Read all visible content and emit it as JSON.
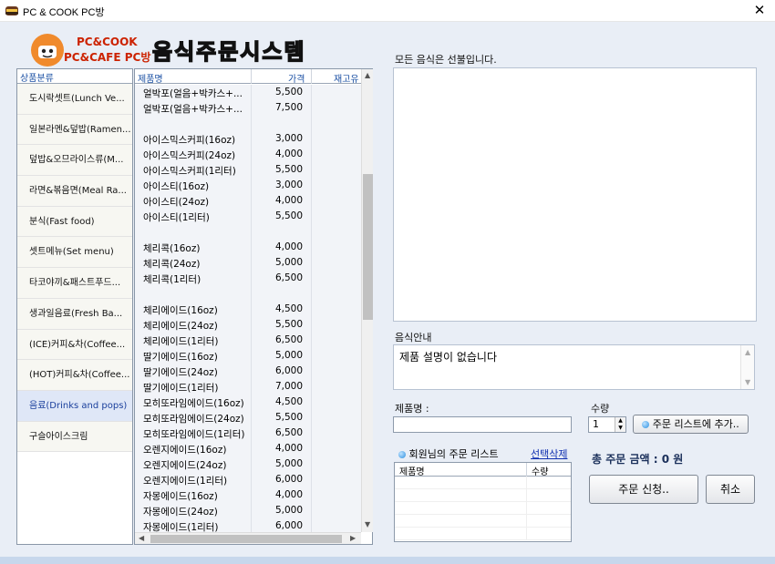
{
  "window": {
    "title": "PC & COOK PC방",
    "close_glyph": "✕"
  },
  "logo": {
    "line1": "PC&COOK",
    "line2": "PC&CAFE PC방",
    "big_title": "음식주문시스템"
  },
  "categories": {
    "header": "상품분류",
    "items": [
      "도시락셋트(Lunch Ve...",
      "일본라멘&덮밥(Ramen...",
      "덮밥&오므라이스류(M...",
      "라면&볶음면(Meal Ra...",
      "분식(Fast food)",
      "셋트메뉴(Set menu)",
      "타코야끼&패스트푸드...",
      "생과일음료(Fresh Ba...",
      "(ICE)커피&차(Coffee...",
      "(HOT)커피&차(Coffee...",
      "음료(Drinks and pops)",
      "구슬아이스크림"
    ],
    "selected_index": 10
  },
  "products": {
    "headers": {
      "name": "제품명",
      "price": "가격",
      "stock": "재고유"
    },
    "rows": [
      [
        "얼박포(얼음+박카스+...",
        "5,500"
      ],
      [
        "얼박포(얼음+박카스+...",
        "7,500"
      ],
      [
        "",
        ""
      ],
      [
        "아이스믹스커피(16oz)",
        "3,000"
      ],
      [
        "아이스믹스커피(24oz)",
        "4,000"
      ],
      [
        "아이스믹스커피(1리터)",
        "5,500"
      ],
      [
        "아이스티(16oz)",
        "3,000"
      ],
      [
        "아이스티(24oz)",
        "4,000"
      ],
      [
        "아이스티(1리터)",
        "5,500"
      ],
      [
        "",
        ""
      ],
      [
        "체리콕(16oz)",
        "4,000"
      ],
      [
        "체리콕(24oz)",
        "5,000"
      ],
      [
        "체리콕(1리터)",
        "6,500"
      ],
      [
        "",
        ""
      ],
      [
        "체리에이드(16oz)",
        "4,500"
      ],
      [
        "체리에이드(24oz)",
        "5,500"
      ],
      [
        "체리에이드(1리터)",
        "6,500"
      ],
      [
        "딸기에이드(16oz)",
        "5,000"
      ],
      [
        "딸기에이드(24oz)",
        "6,000"
      ],
      [
        "딸기에이드(1리터)",
        "7,000"
      ],
      [
        "모히또라임에이드(16oz)",
        "4,500"
      ],
      [
        "모히또라임에이드(24oz)",
        "5,500"
      ],
      [
        "모히또라임에이드(1리터)",
        "6,500"
      ],
      [
        "오렌지에이드(16oz)",
        "4,000"
      ],
      [
        "오렌지에이드(24oz)",
        "5,000"
      ],
      [
        "오렌지에이드(1리터)",
        "6,000"
      ],
      [
        "자몽에이드(16oz)",
        "4,000"
      ],
      [
        "자몽에이드(24oz)",
        "5,000"
      ],
      [
        "자몽에이드(1리터)",
        "6,000"
      ]
    ]
  },
  "right": {
    "prepaid_notice": "모든 음식은 선불입니다.",
    "desc_label": "음식안내",
    "desc_text": "제품 설명이 없습니다",
    "name_label": "제품명 :",
    "qty_label": "수량",
    "qty_value": "1",
    "add_button": "주문 리스트에 추가..",
    "order_list_title": "회원님의 주문 리스트",
    "delete_selected": "선택삭제",
    "order_headers": {
      "name": "제품명",
      "qty": "수량"
    },
    "total_text": "총 주문 금액 : 0 원",
    "order_button": "주문 신청..",
    "cancel_button": "취소"
  }
}
